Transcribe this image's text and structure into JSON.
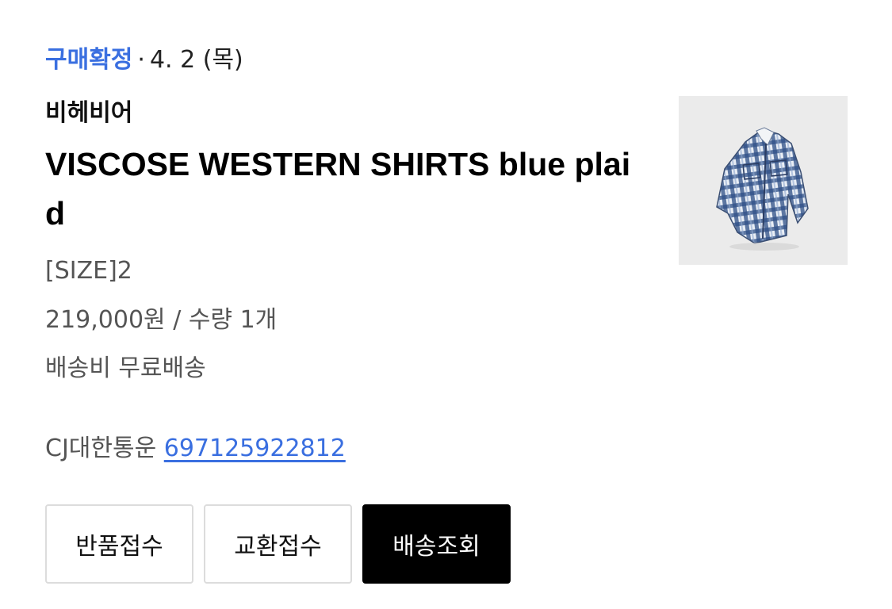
{
  "order": {
    "status_label": "구매확정",
    "separator": "·",
    "date": "4. 2 (목)",
    "brand": "비헤비어",
    "product_name": "VISCOSE WESTERN SHIRTS blue plaid",
    "size": "[SIZE]2",
    "price_qty": "219,000원 / 수량 1개",
    "shipping_fee": "배송비 무료배송",
    "courier": "CJ대한통운",
    "tracking_number": "697125922812"
  },
  "actions": {
    "return_label": "반품접수",
    "exchange_label": "교환접수",
    "track_label": "배송조회"
  },
  "colors": {
    "accent_blue": "#3a6fe0",
    "primary_button": "#000000",
    "thumbnail_bg": "#ebebeb"
  },
  "icons": {
    "product_image": "plaid-shirt-photo"
  }
}
